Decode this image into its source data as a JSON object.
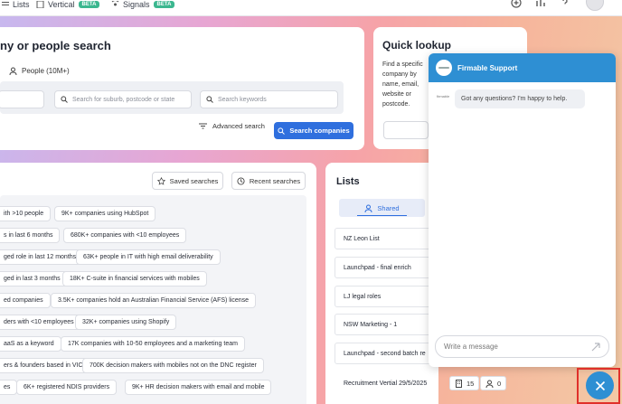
{
  "nav": {
    "items": [
      {
        "label": "Lists"
      },
      {
        "label": "Vertical",
        "badge": "BETA"
      },
      {
        "label": "Signals",
        "badge": "BETA"
      }
    ],
    "icons": [
      "plus-circle-icon",
      "chart-icon",
      "help-icon",
      "user-avatar"
    ]
  },
  "search": {
    "title": "ny or people search",
    "people_tab": "People (10M+)",
    "location_placeholder": "Search for suburb, postcode or state",
    "keywords_placeholder": "Search keywords",
    "advanced_label": "Advanced search",
    "search_button": "Search companies"
  },
  "quick": {
    "title": "Quick lookup",
    "desc": "Find a specific company by name, email, website or postcode."
  },
  "suggest": {
    "saved_label": "Saved searches",
    "recent_label": "Recent searches",
    "chips": [
      "ith >10 people",
      "9K+ companies using HubSpot",
      "s in last 6 months",
      "680K+ companies with <10 employees",
      "ged role in last 12 months",
      "63K+ people in IT with high email deliverability",
      "ged in last 3 months",
      "18K+ C-suite in financial services with mobiles",
      "ed companies",
      "3.5K+ companies hold an Australian Financial Service (AFS) license",
      "ders with <10 employees",
      "32K+ companies using Shopify",
      "aaS as a keyword",
      "17K companies with 10-50 employees and a marketing team",
      "ers & founders based in VIC",
      "700K decision makers with mobiles not on the DNC register",
      "es",
      "6K+ registered NDIS providers",
      "9K+ HR decision makers with email and mobile"
    ]
  },
  "lists": {
    "title": "Lists",
    "shared_tab": "Shared",
    "rows": [
      "NZ Leon List",
      "Launchpad - final enrich",
      "LJ legal roles",
      "NSW Marketing - 1",
      "Launchpad - second batch re",
      "Recruitment Vertial 29/5/2025"
    ],
    "count_companies": "15",
    "count_people": "0"
  },
  "chat": {
    "title": "Firmable Support",
    "logo_text": "firmable",
    "message": "Got any questions? I'm happy to help.",
    "input_placeholder": "Write a message"
  },
  "colors": {
    "accent": "#2f6fde",
    "chat_blue": "#2e8fd3",
    "beta_green": "#3bb78f",
    "highlight_red": "#e0302a"
  }
}
